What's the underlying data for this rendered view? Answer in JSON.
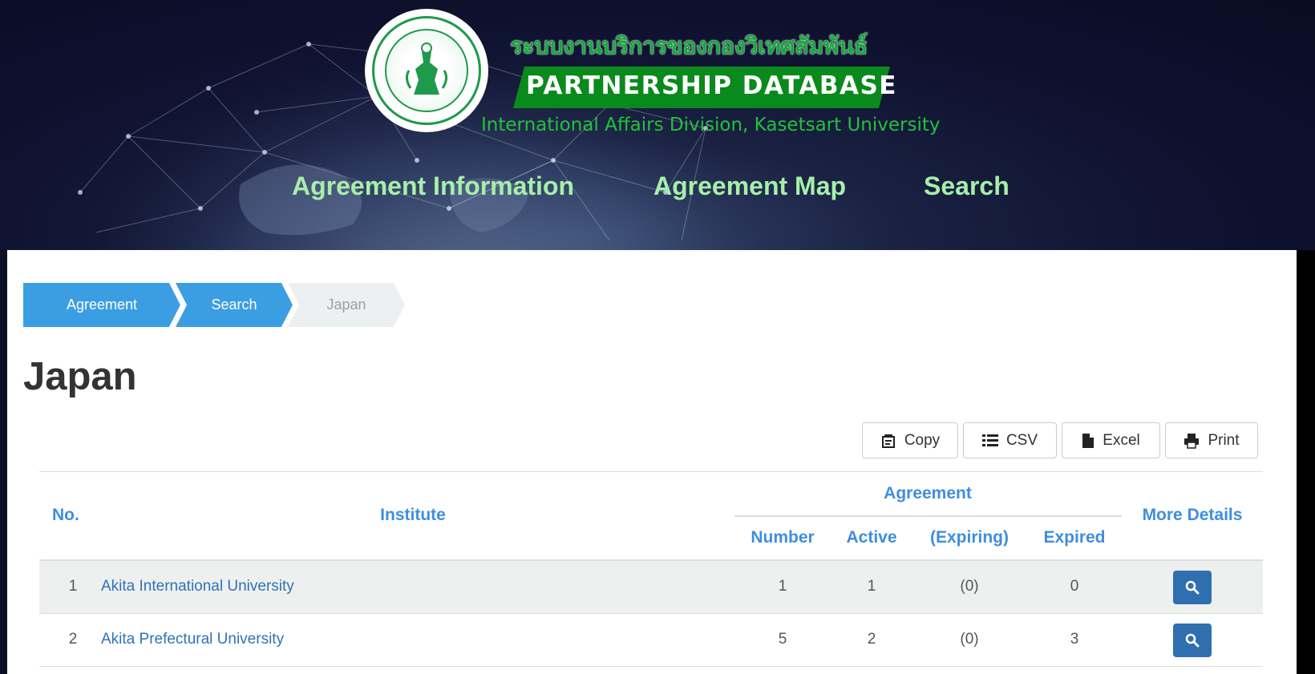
{
  "header": {
    "thai_title": "ระบบงานบริการของกองวิเทศสัมพันธ์",
    "banner_title": "PARTNERSHIP DATABASE",
    "subtitle": "International Affairs Division, Kasetsart University",
    "nav": [
      {
        "label": "Agreement Information"
      },
      {
        "label": "Agreement Map"
      },
      {
        "label": "Search"
      }
    ],
    "colors": {
      "nav_text": "#a6efa9",
      "brand_green": "#0a8a1c"
    }
  },
  "breadcrumb": [
    {
      "label": "Agreement",
      "state": "active"
    },
    {
      "label": "Search",
      "state": "active"
    },
    {
      "label": "Japan",
      "state": "current"
    }
  ],
  "page_title": "Japan",
  "export_buttons": [
    {
      "label": "Copy",
      "icon": "copy-icon"
    },
    {
      "label": "CSV",
      "icon": "list-icon"
    },
    {
      "label": "Excel",
      "icon": "file-icon"
    },
    {
      "label": "Print",
      "icon": "print-icon"
    }
  ],
  "table": {
    "headers": {
      "no": "No.",
      "institute": "Institute",
      "agreement_group": "Agreement",
      "number": "Number",
      "active": "Active",
      "expiring": "(Expiring)",
      "expired": "Expired",
      "more_details": "More Details"
    },
    "rows": [
      {
        "no": "1",
        "institute": "Akita International University",
        "number": "1",
        "active": "1",
        "expiring": "(0)",
        "expired": "0"
      },
      {
        "no": "2",
        "institute": "Akita Prefectural University",
        "number": "5",
        "active": "2",
        "expiring": "(0)",
        "expired": "3"
      }
    ],
    "detail_icon": "search-icon",
    "colors": {
      "header_text": "#3f8ee0",
      "link": "#2f72b8",
      "detail_button": "#2f6fb0",
      "stripe": "#eef0f0"
    }
  }
}
